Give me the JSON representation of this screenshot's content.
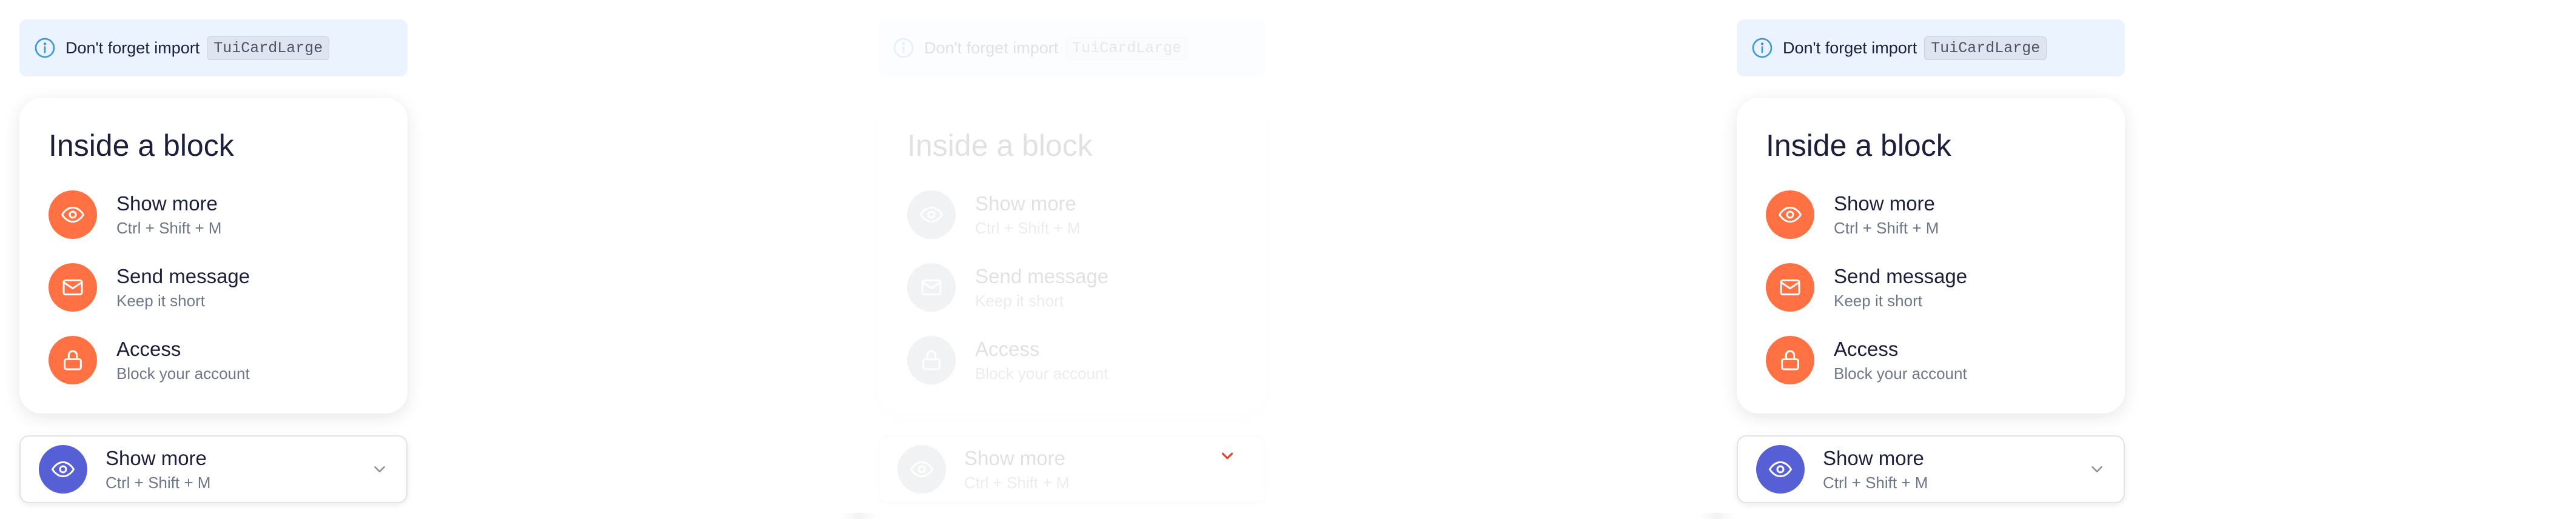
{
  "notice": {
    "text": "Don't forget import",
    "code": "TuiCardLarge"
  },
  "card": {
    "title": "Inside a block",
    "items": [
      {
        "title": "Show more",
        "subtitle": "Ctrl + Shift + M",
        "icon": "eye-icon"
      },
      {
        "title": "Send message",
        "subtitle": "Keep it short",
        "icon": "mail-icon"
      },
      {
        "title": "Access",
        "subtitle": "Block your account",
        "icon": "lock-icon"
      }
    ]
  },
  "collapsed": {
    "title": "Show more",
    "subtitle": "Ctrl + Shift + M",
    "icon": "eye-icon",
    "chevron": "chevron-down-icon"
  },
  "colors": {
    "accent_orange": "#ff7043",
    "accent_indigo": "#5660d4",
    "notice_bg": "#eaf3ff",
    "info_blue": "#3e9ad6",
    "chevron_active": "#e8412c"
  }
}
